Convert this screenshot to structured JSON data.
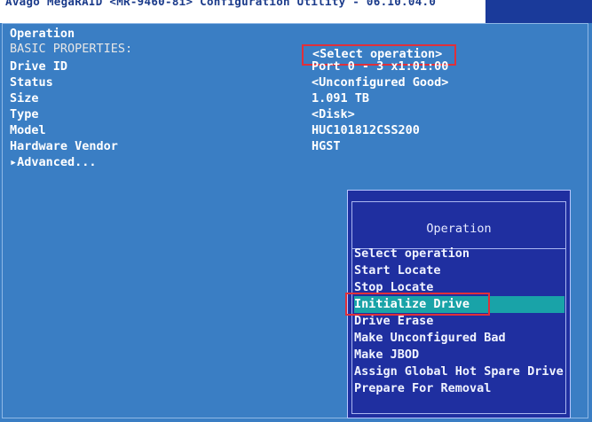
{
  "header": {
    "title": "Avago MegaRAID <MR-9460-8i> Configuration Utility - 06.10.04.0"
  },
  "properties": {
    "operation_label": "Operation",
    "operation_value": "<Select operation>",
    "section_label": "BASIC PROPERTIES:",
    "rows": [
      {
        "label": "Drive ID",
        "value": "Port 0 - 3 x1:01:00"
      },
      {
        "label": "Status",
        "value": "<Unconfigured Good>"
      },
      {
        "label": "Size",
        "value": "1.091 TB"
      },
      {
        "label": "Type",
        "value": "<Disk>"
      },
      {
        "label": "Model",
        "value": "HUC101812CSS200"
      },
      {
        "label": "Hardware Vendor",
        "value": "HGST"
      }
    ],
    "advanced_label": "▸Advanced..."
  },
  "popup": {
    "title": "Operation",
    "options": [
      "Select operation",
      "Start Locate",
      "Stop Locate",
      "Initialize Drive",
      "Drive Erase",
      "Make Unconfigured Bad",
      "Make JBOD",
      "Assign Global Hot Spare Drive",
      "Prepare For Removal"
    ],
    "selected_option": "Initialize Drive"
  },
  "colors": {
    "background": "#3a7ec4",
    "popup_background": "#1f2fa0",
    "selection_highlight": "#19a3a8",
    "annotation_red": "#e0303a"
  }
}
